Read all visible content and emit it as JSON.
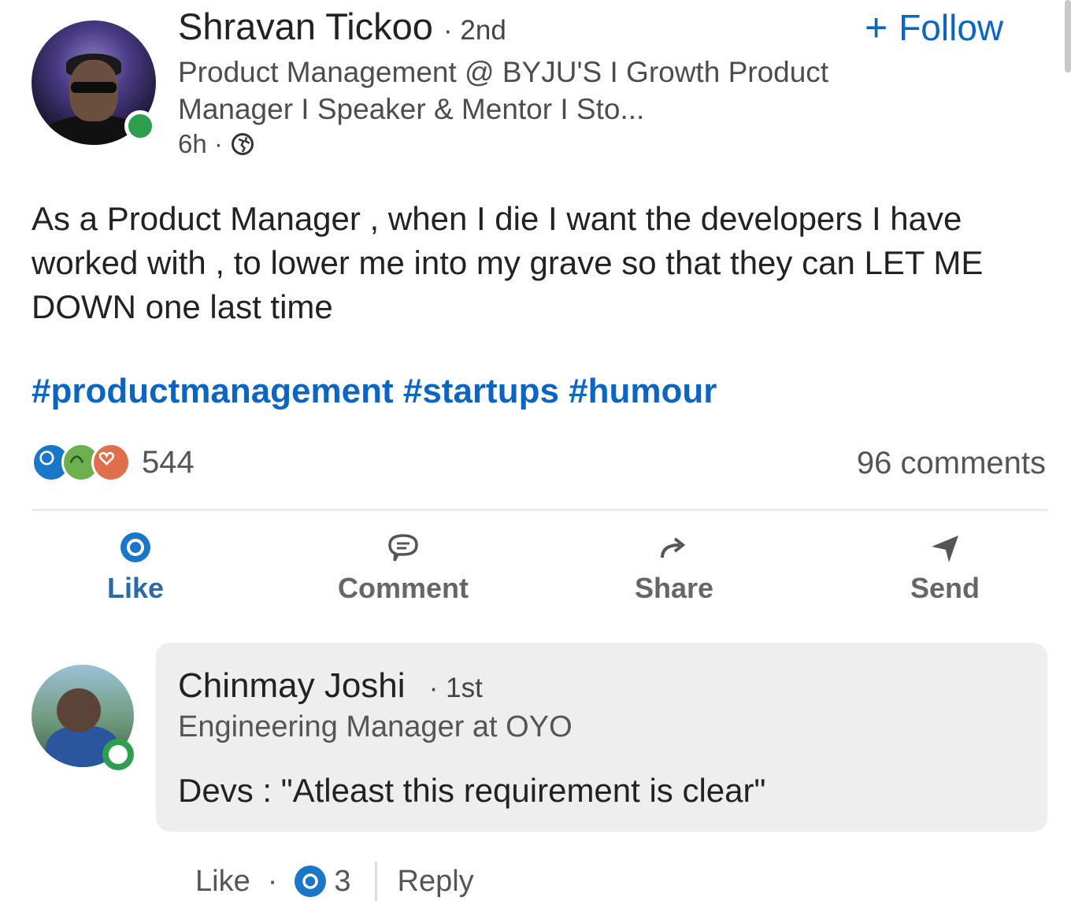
{
  "post": {
    "author": {
      "name": "Shravan Tickoo",
      "degree": "· 2nd",
      "headline": "Product Management @ BYJU'S I Growth Product Manager I Speaker & Mentor I Sto...",
      "time": "6h ·",
      "visibility_icon": "globe-icon"
    },
    "follow_label": "Follow",
    "text": "As a Product Manager , when I die I want the developers I have worked with , to lower me into my grave so that they can LET ME DOWN one last time",
    "hashtags": "#productmanagement #startups #humour",
    "reactions": {
      "icons": [
        "like-reaction-icon",
        "celebrate-reaction-icon",
        "love-reaction-icon"
      ],
      "count": "544"
    },
    "comments_count": "96 comments",
    "actions": [
      {
        "label": "Like",
        "icon": "thumbs-up-icon"
      },
      {
        "label": "Comment",
        "icon": "comment-icon"
      },
      {
        "label": "Share",
        "icon": "share-icon"
      },
      {
        "label": "Send",
        "icon": "send-icon"
      }
    ]
  },
  "comment": {
    "name": "Chinmay Joshi",
    "degree": "· 1st",
    "title": "Engineering Manager at OYO",
    "text": "Devs : \"Atleast this requirement is clear\"",
    "like_label": "Like",
    "dot": "·",
    "like_count": "3",
    "reply_label": "Reply"
  },
  "colors": {
    "accent": "#0a66c2",
    "online": "#2e9e4f",
    "bubble": "#eeeeee"
  }
}
